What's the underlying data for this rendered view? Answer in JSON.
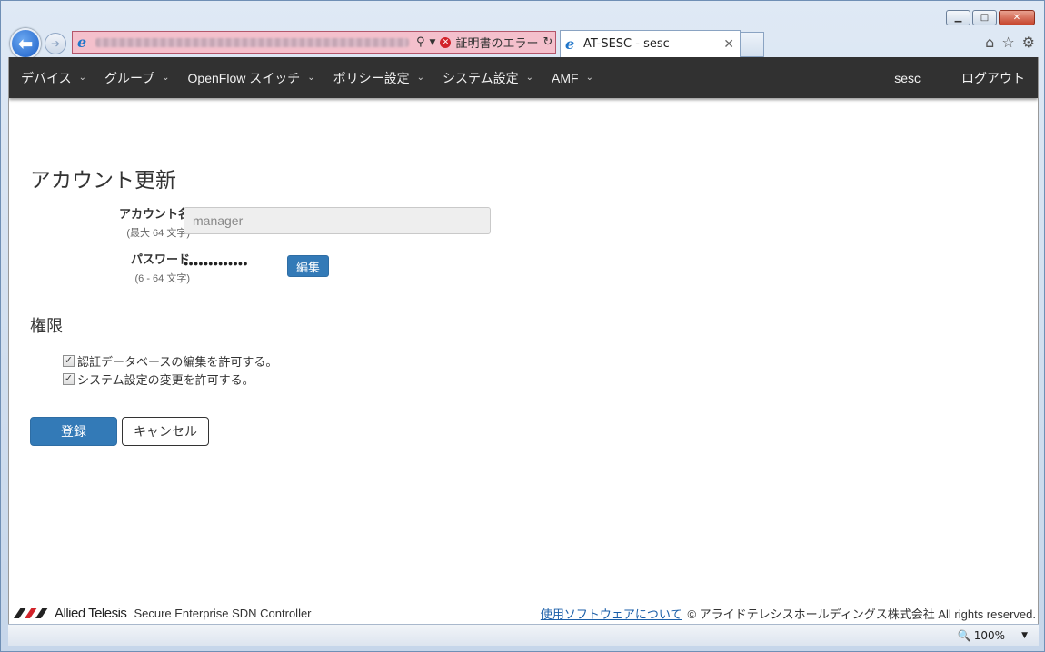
{
  "browser": {
    "address_status": "証明書のエラー",
    "tab_title": "AT-SESC - sesc",
    "zoom": "100%"
  },
  "navbar": {
    "items": [
      {
        "label": "デバイス"
      },
      {
        "label": "グループ"
      },
      {
        "label": "OpenFlow スイッチ"
      },
      {
        "label": "ポリシー設定"
      },
      {
        "label": "システム設定"
      },
      {
        "label": "AMF"
      }
    ],
    "user": "sesc",
    "logout": "ログアウト"
  },
  "page": {
    "title": "アカウント更新",
    "account_label": "アカウント名",
    "account_hint": "(最大 64 文字)",
    "account_value": "manager",
    "password_label": "パスワード",
    "password_hint": "(6 - 64 文字)",
    "password_mask": "●●●●●●●●●●●●●",
    "edit_button": "編集",
    "permissions_title": "権限",
    "permissions": [
      {
        "label": "認証データベースの編集を許可する。",
        "checked": true
      },
      {
        "label": "システム設定の変更を許可する。",
        "checked": true
      }
    ],
    "submit_button": "登録",
    "cancel_button": "キャンセル"
  },
  "footer": {
    "brand": "Allied Telesis",
    "product": "Secure Enterprise SDN Controller",
    "about_link": "使用ソフトウェアについて",
    "copyright": "© アライドテレシスホールディングス株式会社 All rights reserved."
  },
  "colors": {
    "navbar_bg": "#313131",
    "primary": "#337ab7",
    "address_error_bg": "#f4c0cc"
  }
}
